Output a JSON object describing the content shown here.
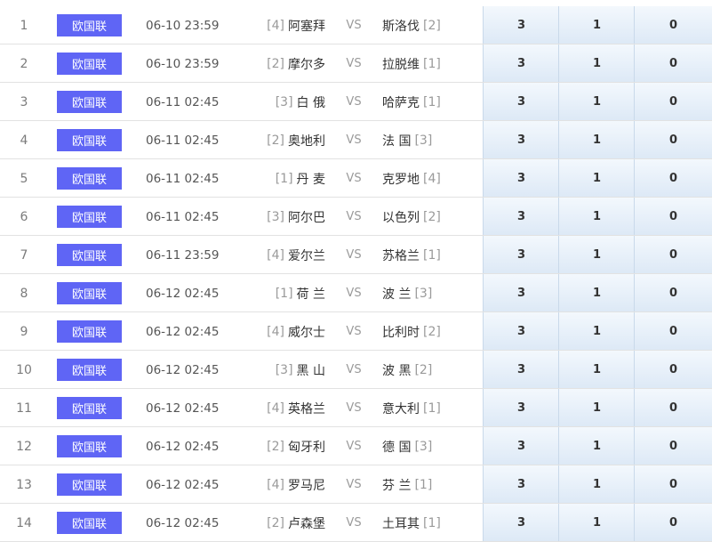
{
  "matches": [
    {
      "index": "1",
      "league": "欧国联",
      "time": "06-10 23:59",
      "home_rank": "[4]",
      "home": "阿塞拜",
      "vs": "VS",
      "away": "斯洛伐",
      "away_rank": "[2]",
      "odds": [
        "3",
        "1",
        "0"
      ]
    },
    {
      "index": "2",
      "league": "欧国联",
      "time": "06-10 23:59",
      "home_rank": "[2]",
      "home": "摩尔多",
      "vs": "VS",
      "away": "拉脱维",
      "away_rank": "[1]",
      "odds": [
        "3",
        "1",
        "0"
      ]
    },
    {
      "index": "3",
      "league": "欧国联",
      "time": "06-11 02:45",
      "home_rank": "[3]",
      "home": "白 俄",
      "vs": "VS",
      "away": "哈萨克",
      "away_rank": "[1]",
      "odds": [
        "3",
        "1",
        "0"
      ]
    },
    {
      "index": "4",
      "league": "欧国联",
      "time": "06-11 02:45",
      "home_rank": "[2]",
      "home": "奥地利",
      "vs": "VS",
      "away": "法 国",
      "away_rank": "[3]",
      "odds": [
        "3",
        "1",
        "0"
      ]
    },
    {
      "index": "5",
      "league": "欧国联",
      "time": "06-11 02:45",
      "home_rank": "[1]",
      "home": "丹 麦",
      "vs": "VS",
      "away": "克罗地",
      "away_rank": "[4]",
      "odds": [
        "3",
        "1",
        "0"
      ]
    },
    {
      "index": "6",
      "league": "欧国联",
      "time": "06-11 02:45",
      "home_rank": "[3]",
      "home": "阿尔巴",
      "vs": "VS",
      "away": "以色列",
      "away_rank": "[2]",
      "odds": [
        "3",
        "1",
        "0"
      ]
    },
    {
      "index": "7",
      "league": "欧国联",
      "time": "06-11 23:59",
      "home_rank": "[4]",
      "home": "爱尔兰",
      "vs": "VS",
      "away": "苏格兰",
      "away_rank": "[1]",
      "odds": [
        "3",
        "1",
        "0"
      ]
    },
    {
      "index": "8",
      "league": "欧国联",
      "time": "06-12 02:45",
      "home_rank": "[1]",
      "home": "荷 兰",
      "vs": "VS",
      "away": "波 兰",
      "away_rank": "[3]",
      "odds": [
        "3",
        "1",
        "0"
      ]
    },
    {
      "index": "9",
      "league": "欧国联",
      "time": "06-12 02:45",
      "home_rank": "[4]",
      "home": "威尔士",
      "vs": "VS",
      "away": "比利时",
      "away_rank": "[2]",
      "odds": [
        "3",
        "1",
        "0"
      ]
    },
    {
      "index": "10",
      "league": "欧国联",
      "time": "06-12 02:45",
      "home_rank": "[3]",
      "home": "黑 山",
      "vs": "VS",
      "away": "波 黑",
      "away_rank": "[2]",
      "odds": [
        "3",
        "1",
        "0"
      ]
    },
    {
      "index": "11",
      "league": "欧国联",
      "time": "06-12 02:45",
      "home_rank": "[4]",
      "home": "英格兰",
      "vs": "VS",
      "away": "意大利",
      "away_rank": "[1]",
      "odds": [
        "3",
        "1",
        "0"
      ]
    },
    {
      "index": "12",
      "league": "欧国联",
      "time": "06-12 02:45",
      "home_rank": "[2]",
      "home": "匈牙利",
      "vs": "VS",
      "away": "德 国",
      "away_rank": "[3]",
      "odds": [
        "3",
        "1",
        "0"
      ]
    },
    {
      "index": "13",
      "league": "欧国联",
      "time": "06-12 02:45",
      "home_rank": "[4]",
      "home": "罗马尼",
      "vs": "VS",
      "away": "芬 兰",
      "away_rank": "[1]",
      "odds": [
        "3",
        "1",
        "0"
      ]
    },
    {
      "index": "14",
      "league": "欧国联",
      "time": "06-12 02:45",
      "home_rank": "[2]",
      "home": "卢森堡",
      "vs": "VS",
      "away": "土耳其",
      "away_rank": "[1]",
      "odds": [
        "3",
        "1",
        "0"
      ]
    }
  ],
  "colors": {
    "league_badge": "#5f65f5",
    "odds_bg": "#dde9f6"
  }
}
